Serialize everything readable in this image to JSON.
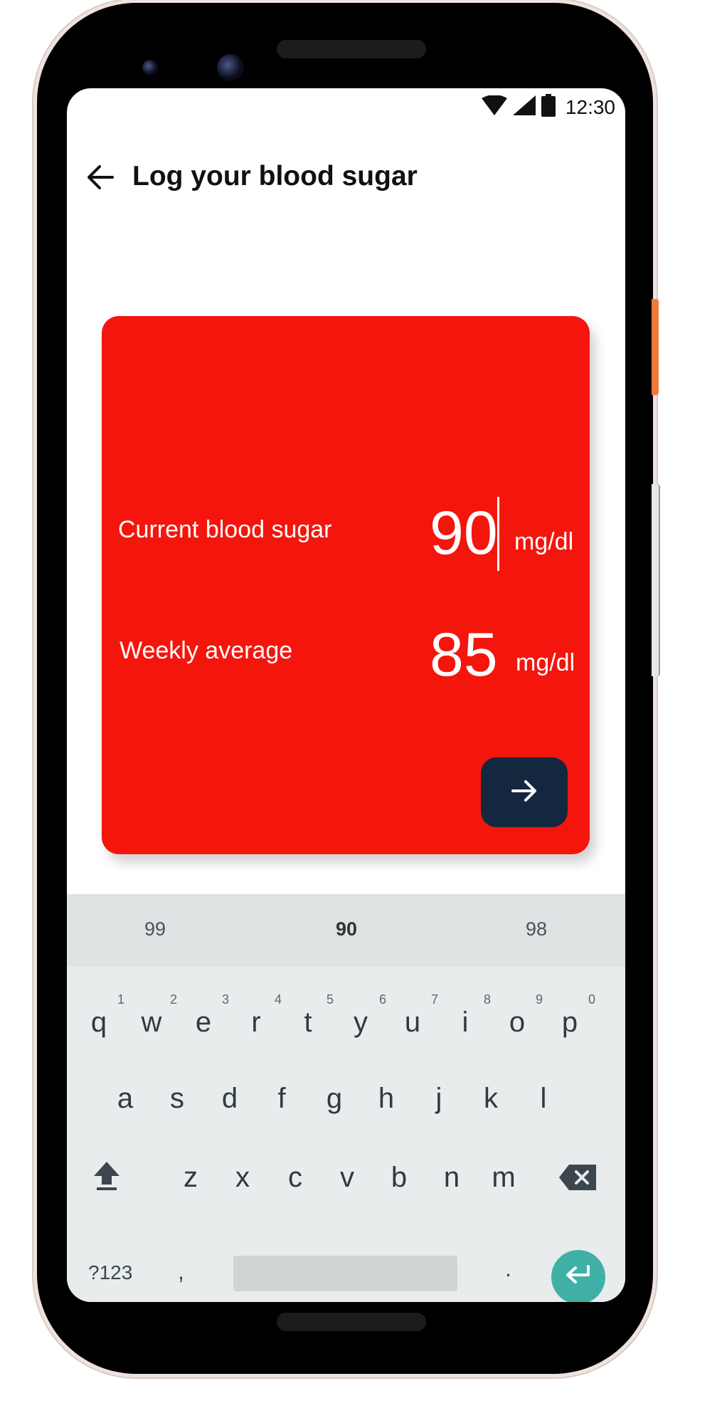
{
  "status_bar": {
    "time": "12:30"
  },
  "app_bar": {
    "title": "Log your blood sugar",
    "back_icon": "arrow-left-icon"
  },
  "card": {
    "background_color": "#f4150d",
    "current": {
      "label": "Current blood sugar",
      "value": "90",
      "unit": "mg/dl"
    },
    "weekly": {
      "label": "Weekly average",
      "value": "85",
      "unit": "mg/dl"
    },
    "next_button": {
      "icon": "arrow-right-icon",
      "color": "#13273e"
    }
  },
  "keyboard": {
    "suggestions": [
      "99",
      "90",
      "98"
    ],
    "row1": [
      {
        "letter": "q",
        "num": "1"
      },
      {
        "letter": "w",
        "num": "2"
      },
      {
        "letter": "e",
        "num": "3"
      },
      {
        "letter": "r",
        "num": "4"
      },
      {
        "letter": "t",
        "num": "5"
      },
      {
        "letter": "y",
        "num": "6"
      },
      {
        "letter": "u",
        "num": "7"
      },
      {
        "letter": "i",
        "num": "8"
      },
      {
        "letter": "o",
        "num": "9"
      },
      {
        "letter": "p",
        "num": "0"
      }
    ],
    "row2": [
      "a",
      "s",
      "d",
      "f",
      "g",
      "h",
      "j",
      "k",
      "l"
    ],
    "row3": [
      "z",
      "x",
      "c",
      "v",
      "b",
      "n",
      "m"
    ],
    "symbols_label": "?123",
    "comma": ",",
    "period": ".",
    "shift_icon": "shift-icon",
    "backspace_icon": "backspace-icon",
    "enter_icon": "enter-icon",
    "accent_color": "#40b0a6"
  }
}
